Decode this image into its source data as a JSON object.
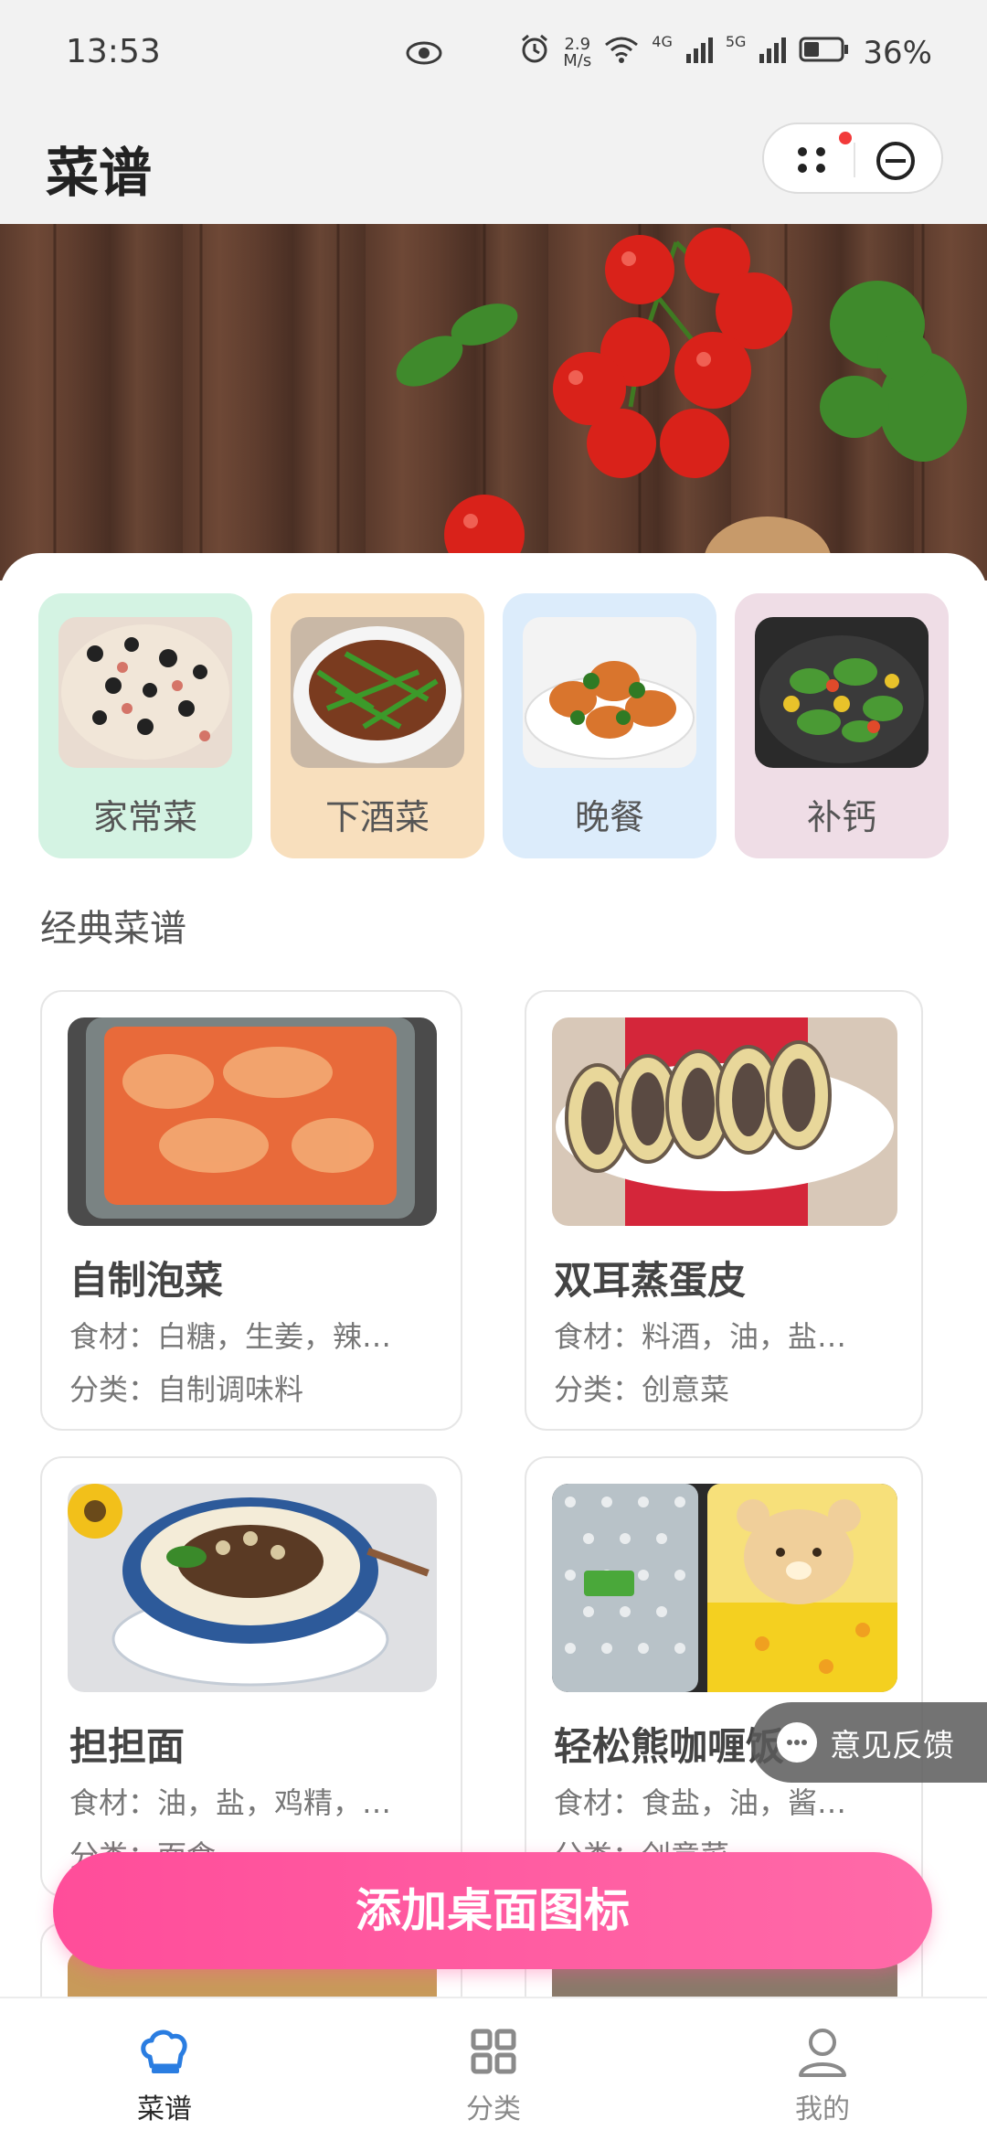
{
  "status_bar": {
    "time": "13:53",
    "speed_value": "2.9",
    "speed_unit": "M/s",
    "net1": "4G",
    "net2": "5G",
    "battery": "36%"
  },
  "header": {
    "title": "菜谱"
  },
  "categories": [
    {
      "label": "家常菜",
      "bg": "#d4f3e3"
    },
    {
      "label": "下酒菜",
      "bg": "#f8dfbd"
    },
    {
      "label": "晚餐",
      "bg": "#dcecfb"
    },
    {
      "label": "补钙",
      "bg": "#efdde6"
    }
  ],
  "section_title": "经典菜谱",
  "recipes": [
    {
      "name": "自制泡菜",
      "ingredients": "食材：白糖，生姜，辣…",
      "category": "分类：自制调味料"
    },
    {
      "name": "双耳蒸蛋皮",
      "ingredients": "食材：料酒，油，盐…",
      "category": "分类：创意菜"
    },
    {
      "name": "担担面",
      "ingredients": "食材：油，盐，鸡精，…",
      "category": "分类：面食"
    },
    {
      "name": "轻松熊咖喱饭",
      "ingredients": "食材：食盐，油，酱…",
      "category": "分类：创意菜"
    }
  ],
  "feedback": {
    "label": "意见反馈"
  },
  "add_button": {
    "label": "添加桌面图标"
  },
  "tabs": [
    {
      "label": "菜谱",
      "active": true
    },
    {
      "label": "分类",
      "active": false
    },
    {
      "label": "我的",
      "active": false
    }
  ],
  "colors": {
    "accent": "#2a7de1",
    "pink": "#ff5aa0",
    "inactive": "#8a8a8a"
  }
}
